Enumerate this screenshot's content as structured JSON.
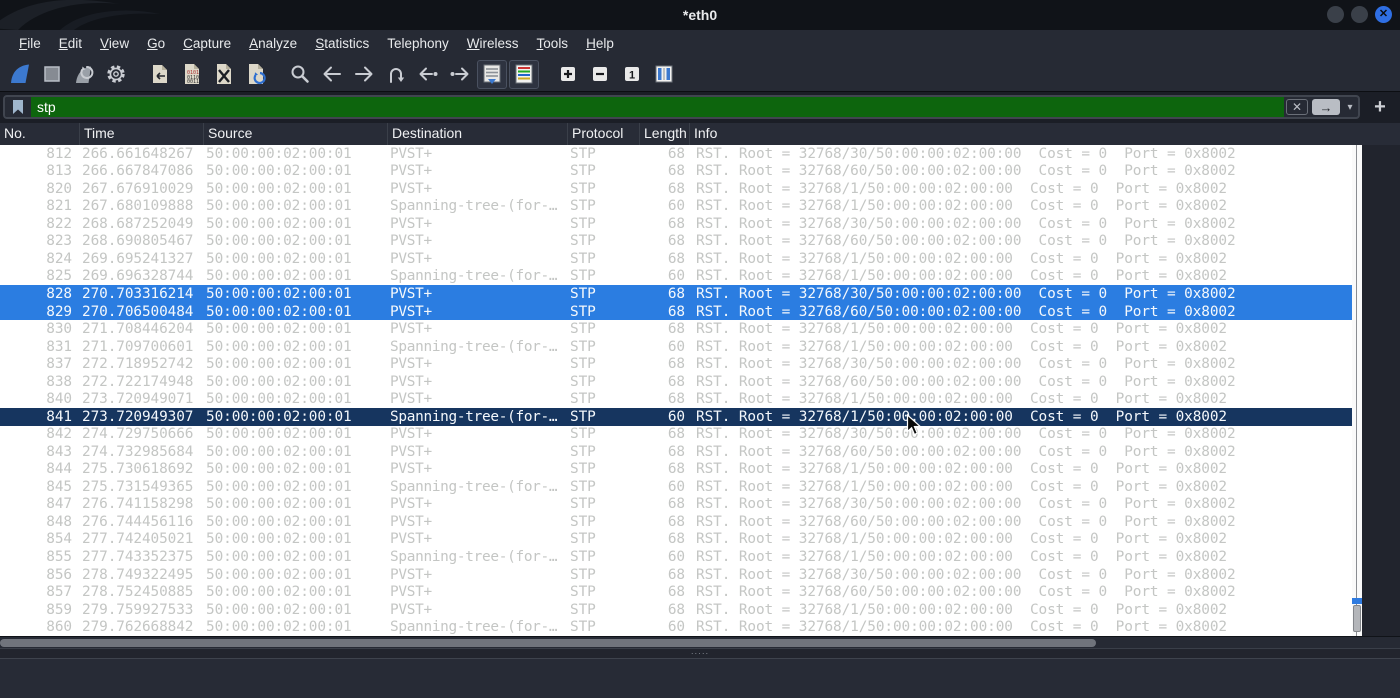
{
  "window": {
    "title": "*eth0"
  },
  "window_controls": [
    "minimize",
    "maximize",
    "close"
  ],
  "menubar": {
    "items": [
      {
        "label": "File",
        "underline": 0
      },
      {
        "label": "Edit",
        "underline": 0
      },
      {
        "label": "View",
        "underline": 0
      },
      {
        "label": "Go",
        "underline": 0
      },
      {
        "label": "Capture",
        "underline": 0
      },
      {
        "label": "Analyze",
        "underline": 0
      },
      {
        "label": "Statistics",
        "underline": 0
      },
      {
        "label": "Telephony",
        "underline": -1
      },
      {
        "label": "Wireless",
        "underline": 0
      },
      {
        "label": "Tools",
        "underline": 0
      },
      {
        "label": "Help",
        "underline": 0
      }
    ]
  },
  "toolbar": {
    "icons": [
      "start-capture",
      "stop-capture",
      "restart-capture",
      "capture-options",
      "open-file",
      "save-file",
      "close-file",
      "reload-file",
      "find-packet",
      "go-back",
      "go-forward",
      "go-to-packet",
      "go-first-packet",
      "go-last-packet",
      "auto-scroll",
      "colorize-packets",
      "zoom-in",
      "zoom-out",
      "zoom-100",
      "resize-columns"
    ]
  },
  "filter": {
    "value": "stp",
    "clear_glyph": "✕",
    "apply_glyph": "→",
    "caret_glyph": "▾",
    "add_glyph": "+",
    "valid_color": "#0d650d"
  },
  "packet_list": {
    "columns": [
      "No.",
      "Time",
      "Source",
      "Destination",
      "Protocol",
      "Length",
      "Info"
    ],
    "rows": [
      {
        "no": "812",
        "time": "266.661648267",
        "src": "50:00:00:02:00:01",
        "dst": "PVST+",
        "proto": "STP",
        "len": "68",
        "info": "RST. Root = 32768/30/50:00:00:02:00:00  Cost = 0  Port = 0x8002",
        "state": "dim"
      },
      {
        "no": "813",
        "time": "266.667847086",
        "src": "50:00:00:02:00:01",
        "dst": "PVST+",
        "proto": "STP",
        "len": "68",
        "info": "RST. Root = 32768/60/50:00:00:02:00:00  Cost = 0  Port = 0x8002",
        "state": "dim"
      },
      {
        "no": "820",
        "time": "267.676910029",
        "src": "50:00:00:02:00:01",
        "dst": "PVST+",
        "proto": "STP",
        "len": "68",
        "info": "RST. Root = 32768/1/50:00:00:02:00:00  Cost = 0  Port = 0x8002",
        "state": "dim"
      },
      {
        "no": "821",
        "time": "267.680109888",
        "src": "50:00:00:02:00:01",
        "dst": "Spanning-tree-(for-…",
        "proto": "STP",
        "len": "60",
        "info": "RST. Root = 32768/1/50:00:00:02:00:00  Cost = 0  Port = 0x8002",
        "state": "dim"
      },
      {
        "no": "822",
        "time": "268.687252049",
        "src": "50:00:00:02:00:01",
        "dst": "PVST+",
        "proto": "STP",
        "len": "68",
        "info": "RST. Root = 32768/30/50:00:00:02:00:00  Cost = 0  Port = 0x8002",
        "state": "dim"
      },
      {
        "no": "823",
        "time": "268.690805467",
        "src": "50:00:00:02:00:01",
        "dst": "PVST+",
        "proto": "STP",
        "len": "68",
        "info": "RST. Root = 32768/60/50:00:00:02:00:00  Cost = 0  Port = 0x8002",
        "state": "dim"
      },
      {
        "no": "824",
        "time": "269.695241327",
        "src": "50:00:00:02:00:01",
        "dst": "PVST+",
        "proto": "STP",
        "len": "68",
        "info": "RST. Root = 32768/1/50:00:00:02:00:00  Cost = 0  Port = 0x8002",
        "state": "dim"
      },
      {
        "no": "825",
        "time": "269.696328744",
        "src": "50:00:00:02:00:01",
        "dst": "Spanning-tree-(for-…",
        "proto": "STP",
        "len": "60",
        "info": "RST. Root = 32768/1/50:00:00:02:00:00  Cost = 0  Port = 0x8002",
        "state": "dim"
      },
      {
        "no": "828",
        "time": "270.703316214",
        "src": "50:00:00:02:00:01",
        "dst": "PVST+",
        "proto": "STP",
        "len": "68",
        "info": "RST. Root = 32768/30/50:00:00:02:00:00  Cost = 0  Port = 0x8002",
        "state": "selected"
      },
      {
        "no": "829",
        "time": "270.706500484",
        "src": "50:00:00:02:00:01",
        "dst": "PVST+",
        "proto": "STP",
        "len": "68",
        "info": "RST. Root = 32768/60/50:00:00:02:00:00  Cost = 0  Port = 0x8002",
        "state": "selected"
      },
      {
        "no": "830",
        "time": "271.708446204",
        "src": "50:00:00:02:00:01",
        "dst": "PVST+",
        "proto": "STP",
        "len": "68",
        "info": "RST. Root = 32768/1/50:00:00:02:00:00  Cost = 0  Port = 0x8002",
        "state": "dim"
      },
      {
        "no": "831",
        "time": "271.709700601",
        "src": "50:00:00:02:00:01",
        "dst": "Spanning-tree-(for-…",
        "proto": "STP",
        "len": "60",
        "info": "RST. Root = 32768/1/50:00:00:02:00:00  Cost = 0  Port = 0x8002",
        "state": "dim"
      },
      {
        "no": "837",
        "time": "272.718952742",
        "src": "50:00:00:02:00:01",
        "dst": "PVST+",
        "proto": "STP",
        "len": "68",
        "info": "RST. Root = 32768/30/50:00:00:02:00:00  Cost = 0  Port = 0x8002",
        "state": "dim"
      },
      {
        "no": "838",
        "time": "272.722174948",
        "src": "50:00:00:02:00:01",
        "dst": "PVST+",
        "proto": "STP",
        "len": "68",
        "info": "RST. Root = 32768/60/50:00:00:02:00:00  Cost = 0  Port = 0x8002",
        "state": "dim"
      },
      {
        "no": "840",
        "time": "273.720949071",
        "src": "50:00:00:02:00:01",
        "dst": "PVST+",
        "proto": "STP",
        "len": "68",
        "info": "RST. Root = 32768/1/50:00:00:02:00:00  Cost = 0  Port = 0x8002",
        "state": "dim"
      },
      {
        "no": "841",
        "time": "273.720949307",
        "src": "50:00:00:02:00:01",
        "dst": "Spanning-tree-(for-…",
        "proto": "STP",
        "len": "60",
        "info": "RST. Root = 32768/1/50:00:00:02:00:00  Cost = 0  Port = 0x8002",
        "state": "current"
      },
      {
        "no": "842",
        "time": "274.729750666",
        "src": "50:00:00:02:00:01",
        "dst": "PVST+",
        "proto": "STP",
        "len": "68",
        "info": "RST. Root = 32768/30/50:00:00:02:00:00  Cost = 0  Port = 0x8002",
        "state": "dim"
      },
      {
        "no": "843",
        "time": "274.732985684",
        "src": "50:00:00:02:00:01",
        "dst": "PVST+",
        "proto": "STP",
        "len": "68",
        "info": "RST. Root = 32768/60/50:00:00:02:00:00  Cost = 0  Port = 0x8002",
        "state": "dim"
      },
      {
        "no": "844",
        "time": "275.730618692",
        "src": "50:00:00:02:00:01",
        "dst": "PVST+",
        "proto": "STP",
        "len": "68",
        "info": "RST. Root = 32768/1/50:00:00:02:00:00  Cost = 0  Port = 0x8002",
        "state": "dim"
      },
      {
        "no": "845",
        "time": "275.731549365",
        "src": "50:00:00:02:00:01",
        "dst": "Spanning-tree-(for-…",
        "proto": "STP",
        "len": "60",
        "info": "RST. Root = 32768/1/50:00:00:02:00:00  Cost = 0  Port = 0x8002",
        "state": "dim"
      },
      {
        "no": "847",
        "time": "276.741158298",
        "src": "50:00:00:02:00:01",
        "dst": "PVST+",
        "proto": "STP",
        "len": "68",
        "info": "RST. Root = 32768/30/50:00:00:02:00:00  Cost = 0  Port = 0x8002",
        "state": "dim"
      },
      {
        "no": "848",
        "time": "276.744456116",
        "src": "50:00:00:02:00:01",
        "dst": "PVST+",
        "proto": "STP",
        "len": "68",
        "info": "RST. Root = 32768/60/50:00:00:02:00:00  Cost = 0  Port = 0x8002",
        "state": "dim"
      },
      {
        "no": "854",
        "time": "277.742405021",
        "src": "50:00:00:02:00:01",
        "dst": "PVST+",
        "proto": "STP",
        "len": "68",
        "info": "RST. Root = 32768/1/50:00:00:02:00:00  Cost = 0  Port = 0x8002",
        "state": "dim"
      },
      {
        "no": "855",
        "time": "277.743352375",
        "src": "50:00:00:02:00:01",
        "dst": "Spanning-tree-(for-…",
        "proto": "STP",
        "len": "60",
        "info": "RST. Root = 32768/1/50:00:00:02:00:00  Cost = 0  Port = 0x8002",
        "state": "dim"
      },
      {
        "no": "856",
        "time": "278.749322495",
        "src": "50:00:00:02:00:01",
        "dst": "PVST+",
        "proto": "STP",
        "len": "68",
        "info": "RST. Root = 32768/30/50:00:00:02:00:00  Cost = 0  Port = 0x8002",
        "state": "dim"
      },
      {
        "no": "857",
        "time": "278.752450885",
        "src": "50:00:00:02:00:01",
        "dst": "PVST+",
        "proto": "STP",
        "len": "68",
        "info": "RST. Root = 32768/60/50:00:00:02:00:00  Cost = 0  Port = 0x8002",
        "state": "dim"
      },
      {
        "no": "859",
        "time": "279.759927533",
        "src": "50:00:00:02:00:01",
        "dst": "PVST+",
        "proto": "STP",
        "len": "68",
        "info": "RST. Root = 32768/1/50:00:00:02:00:00  Cost = 0  Port = 0x8002",
        "state": "dim"
      },
      {
        "no": "860",
        "time": "279.762668842",
        "src": "50:00:00:02:00:01",
        "dst": "Spanning-tree-(for-…",
        "proto": "STP",
        "len": "60",
        "info": "RST. Root = 32768/1/50:00:00:02:00:00  Cost = 0  Port = 0x8002",
        "state": "dim"
      }
    ]
  },
  "colors": {
    "selection_blue": "#2b7de1",
    "current_row_navy": "#16355f",
    "filter_valid_green": "#0d650d",
    "row_text_dim": "#c4c6c4",
    "chrome_dark": "#262a34",
    "accent_close": "#2f6fe4"
  }
}
